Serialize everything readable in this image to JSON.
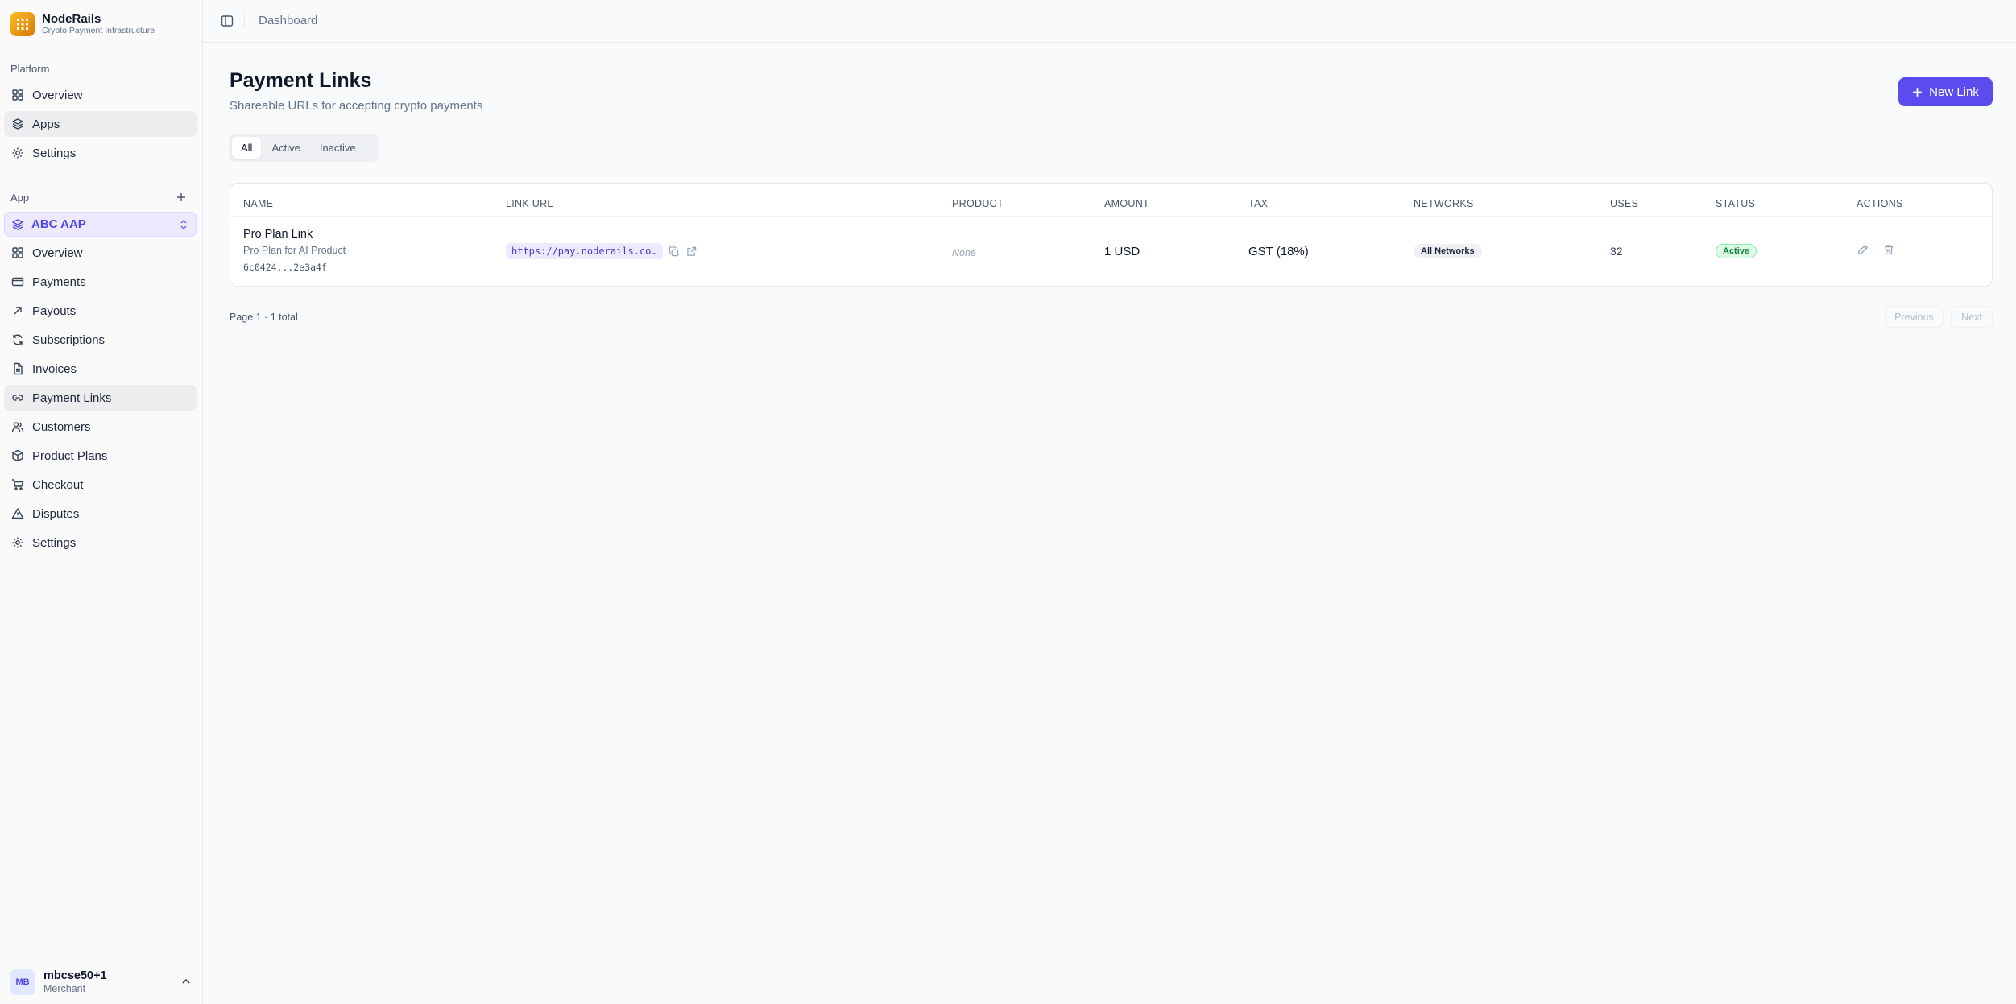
{
  "brand": {
    "name": "NodeRails",
    "subtitle": "Crypto Payment Infrastructure"
  },
  "sidebar": {
    "platform_label": "Platform",
    "platform_items": [
      {
        "label": "Overview",
        "icon": "grid-icon"
      },
      {
        "label": "Apps",
        "icon": "layers-icon",
        "active": true
      },
      {
        "label": "Settings",
        "icon": "gear-icon"
      }
    ],
    "app_label": "App",
    "app_selected": "ABC AAP",
    "app_items": [
      {
        "label": "Overview",
        "icon": "grid-icon"
      },
      {
        "label": "Payments",
        "icon": "credit-card-icon"
      },
      {
        "label": "Payouts",
        "icon": "arrow-up-right-icon"
      },
      {
        "label": "Subscriptions",
        "icon": "refresh-icon"
      },
      {
        "label": "Invoices",
        "icon": "file-text-icon"
      },
      {
        "label": "Payment Links",
        "icon": "link-icon",
        "active": true
      },
      {
        "label": "Customers",
        "icon": "users-icon"
      },
      {
        "label": "Product Plans",
        "icon": "package-icon"
      },
      {
        "label": "Checkout",
        "icon": "cart-icon"
      },
      {
        "label": "Disputes",
        "icon": "alert-triangle-icon"
      },
      {
        "label": "Settings",
        "icon": "gear-icon"
      }
    ],
    "user": {
      "initials": "MB",
      "name": "mbcse50+1",
      "role": "Merchant"
    }
  },
  "topbar": {
    "breadcrumb": "Dashboard"
  },
  "page": {
    "title": "Payment Links",
    "subtitle": "Shareable URLs for accepting crypto payments",
    "new_button": "New Link",
    "tabs": [
      "All",
      "Active",
      "Inactive"
    ],
    "active_tab": "All"
  },
  "table": {
    "headers": [
      "NAME",
      "LINK URL",
      "PRODUCT",
      "AMOUNT",
      "TAX",
      "NETWORKS",
      "USES",
      "STATUS",
      "ACTIONS"
    ],
    "rows": [
      {
        "name": "Pro Plan Link",
        "description": "Pro Plan for AI Product",
        "id": "6c0424...2e3a4f",
        "url": "https://pay.noderails.co…",
        "product": "None",
        "amount": "1 USD",
        "tax": "GST (18%)",
        "networks": "All Networks",
        "uses": "32",
        "status": "Active"
      }
    ]
  },
  "pagination": {
    "summary": "Page 1 · 1 total",
    "previous": "Previous",
    "next": "Next"
  },
  "colors": {
    "accent": "#5b4cf0",
    "active_badge": "#15803d",
    "url_pill": "#ede9fe"
  }
}
